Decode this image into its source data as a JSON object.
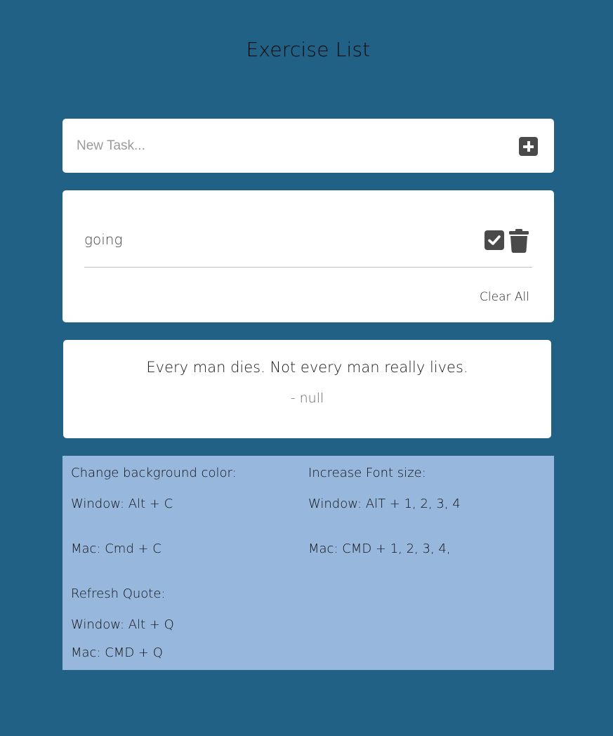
{
  "header": {
    "title": "Exercise List"
  },
  "new_task": {
    "placeholder": "New Task...",
    "add_icon": "plus-square-icon"
  },
  "tasks": [
    {
      "text": "going",
      "complete_icon": "check-square-icon",
      "delete_icon": "trash-icon"
    }
  ],
  "clear_all_label": "Clear All",
  "quote": {
    "text": "Every man dies. Not every man really lives.",
    "author": "- null"
  },
  "shortcuts": {
    "background": {
      "heading": "Change background color:",
      "windows": "Window: Alt + C",
      "mac": "Mac: Cmd + C"
    },
    "font_size": {
      "heading": "Increase Font size:",
      "windows": "Window: AlT + 1, 2, 3, 4",
      "mac": "Mac: CMD + 1, 2, 3, 4,"
    },
    "quote": {
      "heading": "Refresh Quote:",
      "windows": "Window: Alt + Q",
      "mac": "Mac: CMD + Q"
    }
  },
  "colors": {
    "page_background": "#216186",
    "shortcuts_background": "#97b7dd",
    "icon_color": "#4a4a4a",
    "card_background": "#ffffff"
  }
}
